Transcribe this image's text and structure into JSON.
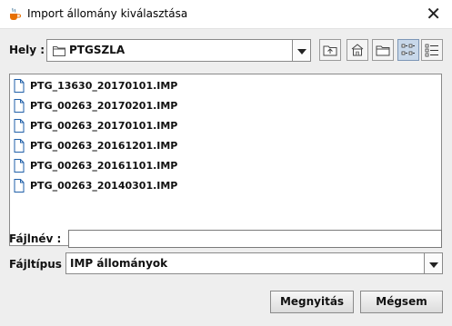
{
  "window": {
    "title": "Import állomány kiválasztása",
    "app_icon": "java-cup-icon",
    "close_icon": "close-icon"
  },
  "look_in": {
    "label": "Hely :",
    "value": "PTGSZLA",
    "icon": "folder-icon"
  },
  "toolbar": {
    "buttons": [
      "up-folder-icon",
      "home-icon",
      "new-folder-icon",
      "list-view-icon",
      "details-view-icon"
    ],
    "selected": "list-view-icon"
  },
  "files": [
    "PTG_13630_20170101.IMP",
    "PTG_00263_20170201.IMP",
    "PTG_00263_20170101.IMP",
    "PTG_00263_20161201.IMP",
    "PTG_00263_20161101.IMP",
    "PTG_00263_20140301.IMP"
  ],
  "filename": {
    "label": "Fájlnév :",
    "value": ""
  },
  "filetype": {
    "label": "Fájltípus :",
    "value": "IMP állományok"
  },
  "buttons": {
    "open": "Megnyitás",
    "cancel": "Mégsem"
  }
}
